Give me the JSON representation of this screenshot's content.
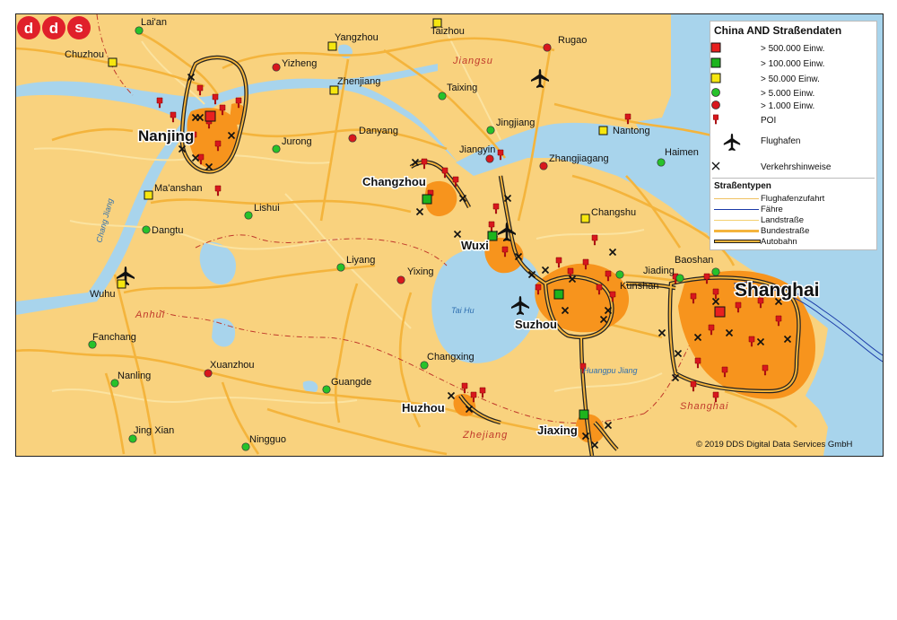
{
  "map": {
    "cities": [
      {
        "name": "Lai'an",
        "tier": "town5k"
      },
      {
        "name": "Chuzhou",
        "tier": "city50k"
      },
      {
        "name": "Yangzhou",
        "tier": "city50k"
      },
      {
        "name": "Taizhou",
        "tier": "city50k"
      },
      {
        "name": "Rugao",
        "tier": "town1k"
      },
      {
        "name": "Yizheng",
        "tier": "town1k"
      },
      {
        "name": "Zhenjiang",
        "tier": "city50k"
      },
      {
        "name": "Taixing",
        "tier": "town5k"
      },
      {
        "name": "Jingjiang",
        "tier": "town5k"
      },
      {
        "name": "Nantong",
        "tier": "city50k"
      },
      {
        "name": "Haimen",
        "tier": "town5k"
      },
      {
        "name": "Jurong",
        "tier": "town5k"
      },
      {
        "name": "Danyang",
        "tier": "town1k"
      },
      {
        "name": "Jiangyin",
        "tier": "town1k"
      },
      {
        "name": "Zhangjiagang",
        "tier": "town1k"
      },
      {
        "name": "Ma'anshan",
        "tier": "city50k"
      },
      {
        "name": "Lishui",
        "tier": "town5k"
      },
      {
        "name": "Changshu",
        "tier": "city50k"
      },
      {
        "name": "Dangtu",
        "tier": "town5k"
      },
      {
        "name": "Liyang",
        "tier": "town5k"
      },
      {
        "name": "Yixing",
        "tier": "town1k"
      },
      {
        "name": "Jiading",
        "tier": "town5k"
      },
      {
        "name": "Baoshan",
        "tier": "town5k"
      },
      {
        "name": "Kunshan",
        "tier": "town5k"
      },
      {
        "name": "Wuhu",
        "tier": "city50k"
      },
      {
        "name": "Fanchang",
        "tier": "town5k"
      },
      {
        "name": "Nanling",
        "tier": "town5k"
      },
      {
        "name": "Xuanzhou",
        "tier": "town1k"
      },
      {
        "name": "Changxing",
        "tier": "town5k"
      },
      {
        "name": "Guangde",
        "tier": "town5k"
      },
      {
        "name": "Jing Xian",
        "tier": "town5k"
      },
      {
        "name": "Ningguo",
        "tier": "town5k"
      }
    ],
    "major_cities": [
      {
        "name": "Nanjing",
        "tier": "city500k"
      },
      {
        "name": "Changzhou",
        "tier": "city100k"
      },
      {
        "name": "Wuxi",
        "tier": "city100k"
      },
      {
        "name": "Suzhou",
        "tier": "city100k"
      },
      {
        "name": "Shanghai",
        "tier": "city500k"
      },
      {
        "name": "Huzhou",
        "tier": "city100k"
      },
      {
        "name": "Jiaxing",
        "tier": "city100k"
      }
    ],
    "regions": [
      "Jiangsu",
      "Anhui",
      "Zhejiang",
      "Shanghai"
    ],
    "water_labels": [
      "Tai Hu",
      "Chang Jiang",
      "Huangpu Jiang"
    ],
    "colors": {
      "land": "#f9d27e",
      "water": "#a8d4ec",
      "urban": "#f7941d",
      "road_main": "#f4b43c",
      "road_minor": "#fbe3a0",
      "autobahn_fill": "#f4b43c",
      "autobahn_outline": "#222222",
      "city500k": "#e8201f",
      "city100k": "#1db41d",
      "city50k": "#f6e60f",
      "town5k": "#27c22a",
      "town1k": "#d8171d",
      "poi": "#d8171d",
      "border": "#c0392b",
      "ferry": "#1a3aa8"
    }
  },
  "legend": {
    "title": "China AND Straßendaten",
    "items": [
      {
        "label": "> 500.000 Einw.",
        "icon": "red-square-icon"
      },
      {
        "label": "> 100.000 Einw.",
        "icon": "green-square-icon"
      },
      {
        "label": "> 50.000 Einw.",
        "icon": "yellow-square-icon"
      },
      {
        "label": "> 5.000 Einw.",
        "icon": "green-dot-icon"
      },
      {
        "label": "> 1.000 Einw.",
        "icon": "red-dot-icon"
      },
      {
        "label": "POI",
        "icon": "poi-pin-icon"
      },
      {
        "label": "Flughafen",
        "icon": "airplane-icon"
      },
      {
        "label": "Verkehrshinweise",
        "icon": "traffic-x-icon"
      }
    ],
    "roads_title": "Straßentypen",
    "roads": [
      {
        "label": "Flughafenzufahrt",
        "color": "#f0c060"
      },
      {
        "label": "Fähre",
        "color": "#1a3aa8"
      },
      {
        "label": "Landstraße",
        "color": "#f4d070"
      },
      {
        "label": "Bundestraße",
        "color": "#f4b43c"
      },
      {
        "label": "Autobahn",
        "color": "#f4b43c"
      }
    ]
  },
  "copyright": "© 2019 DDS Digital Data Services GmbH",
  "logo_text": "dds"
}
